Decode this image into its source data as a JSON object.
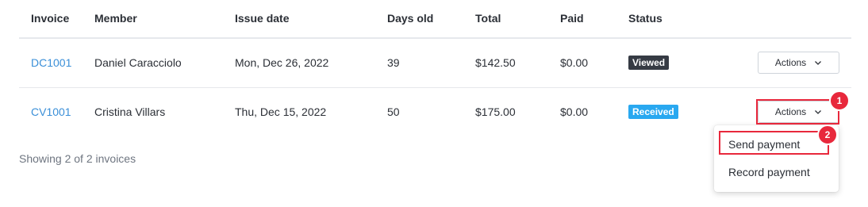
{
  "table": {
    "headers": {
      "invoice": "Invoice",
      "member": "Member",
      "issue_date": "Issue date",
      "days_old": "Days old",
      "total": "Total",
      "paid": "Paid",
      "status": "Status"
    },
    "rows": [
      {
        "invoice": "DC1001",
        "member": "Daniel Caracciolo",
        "issue_date": "Mon, Dec 26, 2022",
        "days_old": "39",
        "total": "$142.50",
        "paid": "$0.00",
        "status": "Viewed",
        "status_color": "#363b44",
        "actions_label": "Actions"
      },
      {
        "invoice": "CV1001",
        "member": "Cristina Villars",
        "issue_date": "Thu, Dec 15, 2022",
        "days_old": "50",
        "total": "$175.00",
        "paid": "$0.00",
        "status": "Received",
        "status_color": "#29a8f0",
        "actions_label": "Actions"
      }
    ]
  },
  "footer": {
    "summary": "Showing 2 of 2 invoices"
  },
  "actions_menu": {
    "items": [
      "Send payment",
      "Record payment"
    ]
  },
  "annotations": {
    "marker_1": "1",
    "marker_2": "2",
    "color": "#e8283c"
  },
  "icons": {
    "chevron": "chevron-down-icon"
  },
  "colors": {
    "link": "#3a8fd8",
    "border": "#e6e8ec"
  }
}
